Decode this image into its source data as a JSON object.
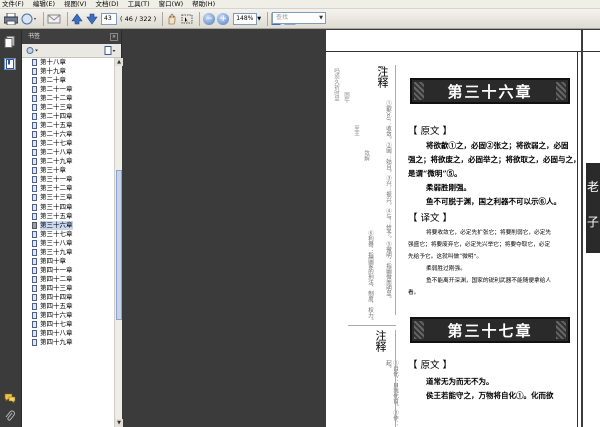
{
  "menu": [
    "文件(F)",
    "编辑(E)",
    "视图(V)",
    "文档(D)",
    "工具(T)",
    "窗口(W)",
    "帮助(H)"
  ],
  "toolbar": {
    "page_input": "43",
    "page_total": "( 46 / 322 )",
    "zoom": "148%",
    "search_placeholder": "查找"
  },
  "panel": {
    "title": "书签"
  },
  "bookmarks": [
    "第十八章",
    "第十九章",
    "第二十章",
    "第二十一章",
    "第二十二章",
    "第二十三章",
    "第二十四章",
    "第二十五章",
    "第二十六章",
    "第二十七章",
    "第二十八章",
    "第二十九章",
    "第三十章",
    "第三十一章",
    "第三十二章",
    "第三十三章",
    "第三十四章",
    "第三十五章",
    "第三十六章",
    "第三十七章",
    "第三十八章",
    "第三十九章",
    "第四十章",
    "第四十一章",
    "第四十二章",
    "第四十三章",
    "第四十四章",
    "第四十五章",
    "第四十六章",
    "第四十七章",
    "第四十八章",
    "第四十九章"
  ],
  "selected_bookmark": "第三十六章",
  "page": {
    "side_text_1": "吗须久祈时显",
    "side_text_2": "固午",
    "side_text_3": "至主",
    "side_text_4": "敛解",
    "zhushi_label": "注释",
    "zhushi_col_1": "①歙(xì)：收敛。②固：姑且。③兴：振兴。④与：给予。⑤微明：指幽微而明显。",
    "zhushi_col_2": "⑥利器：指国家的刑法、制度、权力。",
    "chapter36_title": "第三十六章",
    "yuanwen_label": "【 原文 】",
    "yuanwen_1": "将欲歙①之，必固②张之；将欲弱之，必固",
    "yuanwen_2": "强之；将欲废之，必固举之；将欲取之，必固与之，",
    "yuanwen_3": "是谓“微明”⑤。",
    "yuanwen_4": "柔弱胜刚强。",
    "yuanwen_5": "鱼不可脱于渊，国之利器不可以示⑥人。",
    "yiwen_label": "【 译文 】",
    "yiwen_1": "将要收敛它，必定先扩张它；将要削弱它，必定先",
    "yiwen_2": "强盛它；将要废弃它，必定先兴举它；将要夺取它，必定",
    "yiwen_3": "先给予它。这就叫做“微明”。",
    "yiwen_4": "柔弱胜过刚强。",
    "yiwen_5": "鱼不能离开深渊，国家的锐利武器不能随便拿给人",
    "yiwen_6": "看。",
    "zhushi2_label": "注释",
    "zhushi2_col_1": "①自化：自我化育。②作：起。",
    "chapter37_title": "第三十七章",
    "yuanwen2_label": "【 原文 】",
    "yuanwen2_1": "道常无为而无不为。",
    "yuanwen2_2": "侯王若能守之，万物将自化①。化而欲",
    "right_char_1": "老",
    "right_char_2": "子"
  },
  "colors": {
    "banner": "#2a2a2a",
    "selection": "#c9d7ef"
  }
}
